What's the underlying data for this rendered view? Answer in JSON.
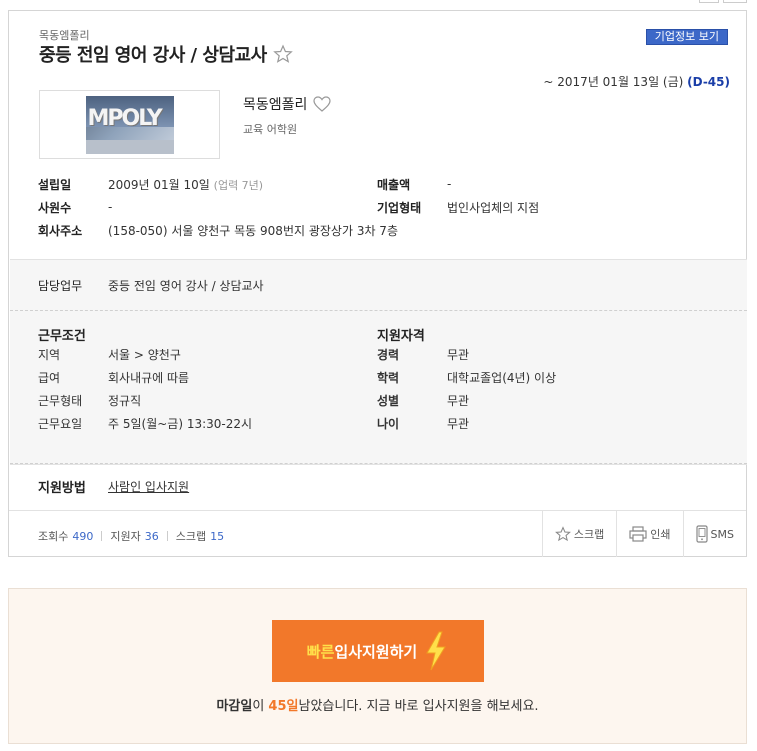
{
  "header": {
    "company_small": "목동엠폴리",
    "job_title": "중등 전임 영어 강사 / 상담교사",
    "info_button": "기업정보 보기",
    "deadline_text": "~ 2017년 01월 13일 (금)",
    "dday": "(D-45)"
  },
  "company": {
    "logo_text": "MPOLY",
    "name": "목동엠폴리",
    "industry": "교육 어학원"
  },
  "details": {
    "founded_label": "설립일",
    "founded_value": "2009년 01월 10일",
    "founded_sub": "(업력 7년)",
    "revenue_label": "매출액",
    "revenue_value": "-",
    "employees_label": "사원수",
    "employees_value": "-",
    "company_type_label": "기업형태",
    "company_type_value": "법인사업체의 지점",
    "address_label": "회사주소",
    "address_value": "(158-050) 서울 양천구 목동 908번지 광장상가 3차 7층"
  },
  "duty": {
    "label": "담당업무",
    "value": "중등 전임 영어 강사 / 상담교사"
  },
  "conditions": {
    "heading": "근무조건",
    "region_label": "지역",
    "region_value": "서울 > 양천구",
    "salary_label": "급여",
    "salary_value": "회사내규에 따름",
    "type_label": "근무형태",
    "type_value": "정규직",
    "days_label": "근무요일",
    "days_value": "주 5일(월~금) 13:30-22시"
  },
  "qualifications": {
    "heading": "지원자격",
    "career_label": "경력",
    "career_value": "무관",
    "education_label": "학력",
    "education_value": "대학교졸업(4년) 이상",
    "gender_label": "성별",
    "gender_value": "무관",
    "age_label": "나이",
    "age_value": "무관"
  },
  "apply": {
    "label": "지원방법",
    "link": "사람인 입사지원"
  },
  "stats": {
    "views_label": "조회수",
    "views_value": "490",
    "applicants_label": "지원자",
    "applicants_value": "36",
    "scraps_label": "스크랩",
    "scraps_value": "15"
  },
  "actions": {
    "scrap": "스크랩",
    "print": "인쇄",
    "sms": "SMS"
  },
  "quick_apply": {
    "fast": "빠른",
    "rest": "입사지원하기",
    "msg_a": "마감일",
    "msg_b": "이 ",
    "msg_days": "45일",
    "msg_c": "남았습니다. 지금 바로 입사지원을 해보세요."
  },
  "colors": {
    "accent_blue": "#3c68c8",
    "dday_blue": "#1a3ea8",
    "orange": "#f2782a"
  }
}
